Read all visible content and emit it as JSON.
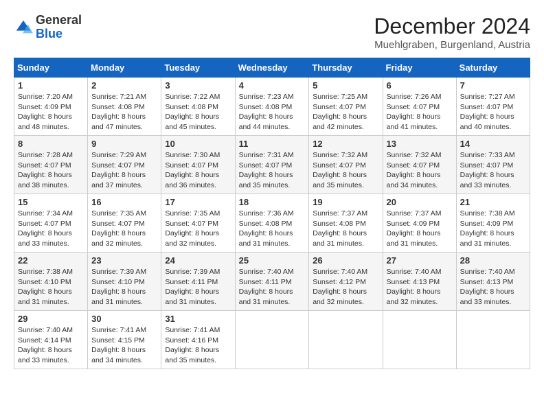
{
  "logo": {
    "general": "General",
    "blue": "Blue"
  },
  "header": {
    "month": "December 2024",
    "location": "Muehlgraben, Burgenland, Austria"
  },
  "columns": [
    "Sunday",
    "Monday",
    "Tuesday",
    "Wednesday",
    "Thursday",
    "Friday",
    "Saturday"
  ],
  "weeks": [
    [
      {
        "day": "1",
        "sunrise": "7:20 AM",
        "sunset": "4:09 PM",
        "daylight": "8 hours and 48 minutes."
      },
      {
        "day": "2",
        "sunrise": "7:21 AM",
        "sunset": "4:08 PM",
        "daylight": "8 hours and 47 minutes."
      },
      {
        "day": "3",
        "sunrise": "7:22 AM",
        "sunset": "4:08 PM",
        "daylight": "8 hours and 45 minutes."
      },
      {
        "day": "4",
        "sunrise": "7:23 AM",
        "sunset": "4:08 PM",
        "daylight": "8 hours and 44 minutes."
      },
      {
        "day": "5",
        "sunrise": "7:25 AM",
        "sunset": "4:07 PM",
        "daylight": "8 hours and 42 minutes."
      },
      {
        "day": "6",
        "sunrise": "7:26 AM",
        "sunset": "4:07 PM",
        "daylight": "8 hours and 41 minutes."
      },
      {
        "day": "7",
        "sunrise": "7:27 AM",
        "sunset": "4:07 PM",
        "daylight": "8 hours and 40 minutes."
      }
    ],
    [
      {
        "day": "8",
        "sunrise": "7:28 AM",
        "sunset": "4:07 PM",
        "daylight": "8 hours and 38 minutes."
      },
      {
        "day": "9",
        "sunrise": "7:29 AM",
        "sunset": "4:07 PM",
        "daylight": "8 hours and 37 minutes."
      },
      {
        "day": "10",
        "sunrise": "7:30 AM",
        "sunset": "4:07 PM",
        "daylight": "8 hours and 36 minutes."
      },
      {
        "day": "11",
        "sunrise": "7:31 AM",
        "sunset": "4:07 PM",
        "daylight": "8 hours and 35 minutes."
      },
      {
        "day": "12",
        "sunrise": "7:32 AM",
        "sunset": "4:07 PM",
        "daylight": "8 hours and 35 minutes."
      },
      {
        "day": "13",
        "sunrise": "7:32 AM",
        "sunset": "4:07 PM",
        "daylight": "8 hours and 34 minutes."
      },
      {
        "day": "14",
        "sunrise": "7:33 AM",
        "sunset": "4:07 PM",
        "daylight": "8 hours and 33 minutes."
      }
    ],
    [
      {
        "day": "15",
        "sunrise": "7:34 AM",
        "sunset": "4:07 PM",
        "daylight": "8 hours and 33 minutes."
      },
      {
        "day": "16",
        "sunrise": "7:35 AM",
        "sunset": "4:07 PM",
        "daylight": "8 hours and 32 minutes."
      },
      {
        "day": "17",
        "sunrise": "7:35 AM",
        "sunset": "4:07 PM",
        "daylight": "8 hours and 32 minutes."
      },
      {
        "day": "18",
        "sunrise": "7:36 AM",
        "sunset": "4:08 PM",
        "daylight": "8 hours and 31 minutes."
      },
      {
        "day": "19",
        "sunrise": "7:37 AM",
        "sunset": "4:08 PM",
        "daylight": "8 hours and 31 minutes."
      },
      {
        "day": "20",
        "sunrise": "7:37 AM",
        "sunset": "4:09 PM",
        "daylight": "8 hours and 31 minutes."
      },
      {
        "day": "21",
        "sunrise": "7:38 AM",
        "sunset": "4:09 PM",
        "daylight": "8 hours and 31 minutes."
      }
    ],
    [
      {
        "day": "22",
        "sunrise": "7:38 AM",
        "sunset": "4:10 PM",
        "daylight": "8 hours and 31 minutes."
      },
      {
        "day": "23",
        "sunrise": "7:39 AM",
        "sunset": "4:10 PM",
        "daylight": "8 hours and 31 minutes."
      },
      {
        "day": "24",
        "sunrise": "7:39 AM",
        "sunset": "4:11 PM",
        "daylight": "8 hours and 31 minutes."
      },
      {
        "day": "25",
        "sunrise": "7:40 AM",
        "sunset": "4:11 PM",
        "daylight": "8 hours and 31 minutes."
      },
      {
        "day": "26",
        "sunrise": "7:40 AM",
        "sunset": "4:12 PM",
        "daylight": "8 hours and 32 minutes."
      },
      {
        "day": "27",
        "sunrise": "7:40 AM",
        "sunset": "4:13 PM",
        "daylight": "8 hours and 32 minutes."
      },
      {
        "day": "28",
        "sunrise": "7:40 AM",
        "sunset": "4:13 PM",
        "daylight": "8 hours and 33 minutes."
      }
    ],
    [
      {
        "day": "29",
        "sunrise": "7:40 AM",
        "sunset": "4:14 PM",
        "daylight": "8 hours and 33 minutes."
      },
      {
        "day": "30",
        "sunrise": "7:41 AM",
        "sunset": "4:15 PM",
        "daylight": "8 hours and 34 minutes."
      },
      {
        "day": "31",
        "sunrise": "7:41 AM",
        "sunset": "4:16 PM",
        "daylight": "8 hours and 35 minutes."
      },
      null,
      null,
      null,
      null
    ]
  ]
}
